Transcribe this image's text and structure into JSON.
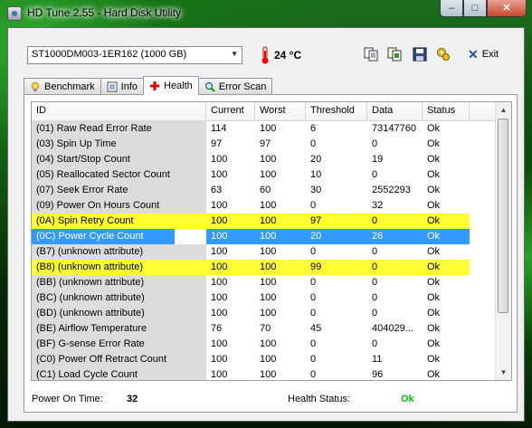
{
  "window": {
    "title": "HD Tune 2.55 - Hard Disk Utility"
  },
  "toolbar": {
    "drive": "ST1000DM003-1ER162 (1000 GB)",
    "temperature": "24 °C",
    "exit_label": "Exit"
  },
  "tabs": [
    {
      "label": "Benchmark"
    },
    {
      "label": "Info"
    },
    {
      "label": "Health"
    },
    {
      "label": "Error Scan"
    }
  ],
  "table": {
    "headers": [
      "ID",
      "Current",
      "Worst",
      "Threshold",
      "Data",
      "Status"
    ],
    "rows": [
      [
        "(01) Raw Read Error Rate",
        "114",
        "100",
        "6",
        "73147760",
        "Ok"
      ],
      [
        "(03) Spin Up Time",
        "97",
        "97",
        "0",
        "0",
        "Ok"
      ],
      [
        "(04) Start/Stop Count",
        "100",
        "100",
        "20",
        "19",
        "Ok"
      ],
      [
        "(05) Reallocated Sector Count",
        "100",
        "100",
        "10",
        "0",
        "Ok"
      ],
      [
        "(07) Seek Error Rate",
        "63",
        "60",
        "30",
        "2552293",
        "Ok"
      ],
      [
        "(09) Power On Hours Count",
        "100",
        "100",
        "0",
        "32",
        "Ok"
      ],
      [
        "(0A) Spin Retry Count",
        "100",
        "100",
        "97",
        "0",
        "Ok"
      ],
      [
        "(0C) Power Cycle Count",
        "100",
        "100",
        "20",
        "26",
        "Ok"
      ],
      [
        "(B7) (unknown attribute)",
        "100",
        "100",
        "0",
        "0",
        "Ok"
      ],
      [
        "(B8) (unknown attribute)",
        "100",
        "100",
        "99",
        "0",
        "Ok"
      ],
      [
        "(BB) (unknown attribute)",
        "100",
        "100",
        "0",
        "0",
        "Ok"
      ],
      [
        "(BC) (unknown attribute)",
        "100",
        "100",
        "0",
        "0",
        "Ok"
      ],
      [
        "(BD) (unknown attribute)",
        "100",
        "100",
        "0",
        "0",
        "Ok"
      ],
      [
        "(BE) Airflow Temperature",
        "76",
        "70",
        "45",
        "404029...",
        "Ok"
      ],
      [
        "(BF) G-sense Error Rate",
        "100",
        "100",
        "0",
        "0",
        "Ok"
      ],
      [
        "(C0) Power Off Retract Count",
        "100",
        "100",
        "0",
        "11",
        "Ok"
      ],
      [
        "(C1) Load Cycle Count",
        "100",
        "100",
        "0",
        "96",
        "Ok"
      ]
    ]
  },
  "footer": {
    "power_on_label": "Power On Time:",
    "power_on_value": "32",
    "health_label": "Health Status:",
    "health_value": "Ok"
  },
  "colors": {
    "highlight_yellow": "#ffff33",
    "selected_blue": "#3399ff",
    "health_ok_green": "#00c000"
  }
}
